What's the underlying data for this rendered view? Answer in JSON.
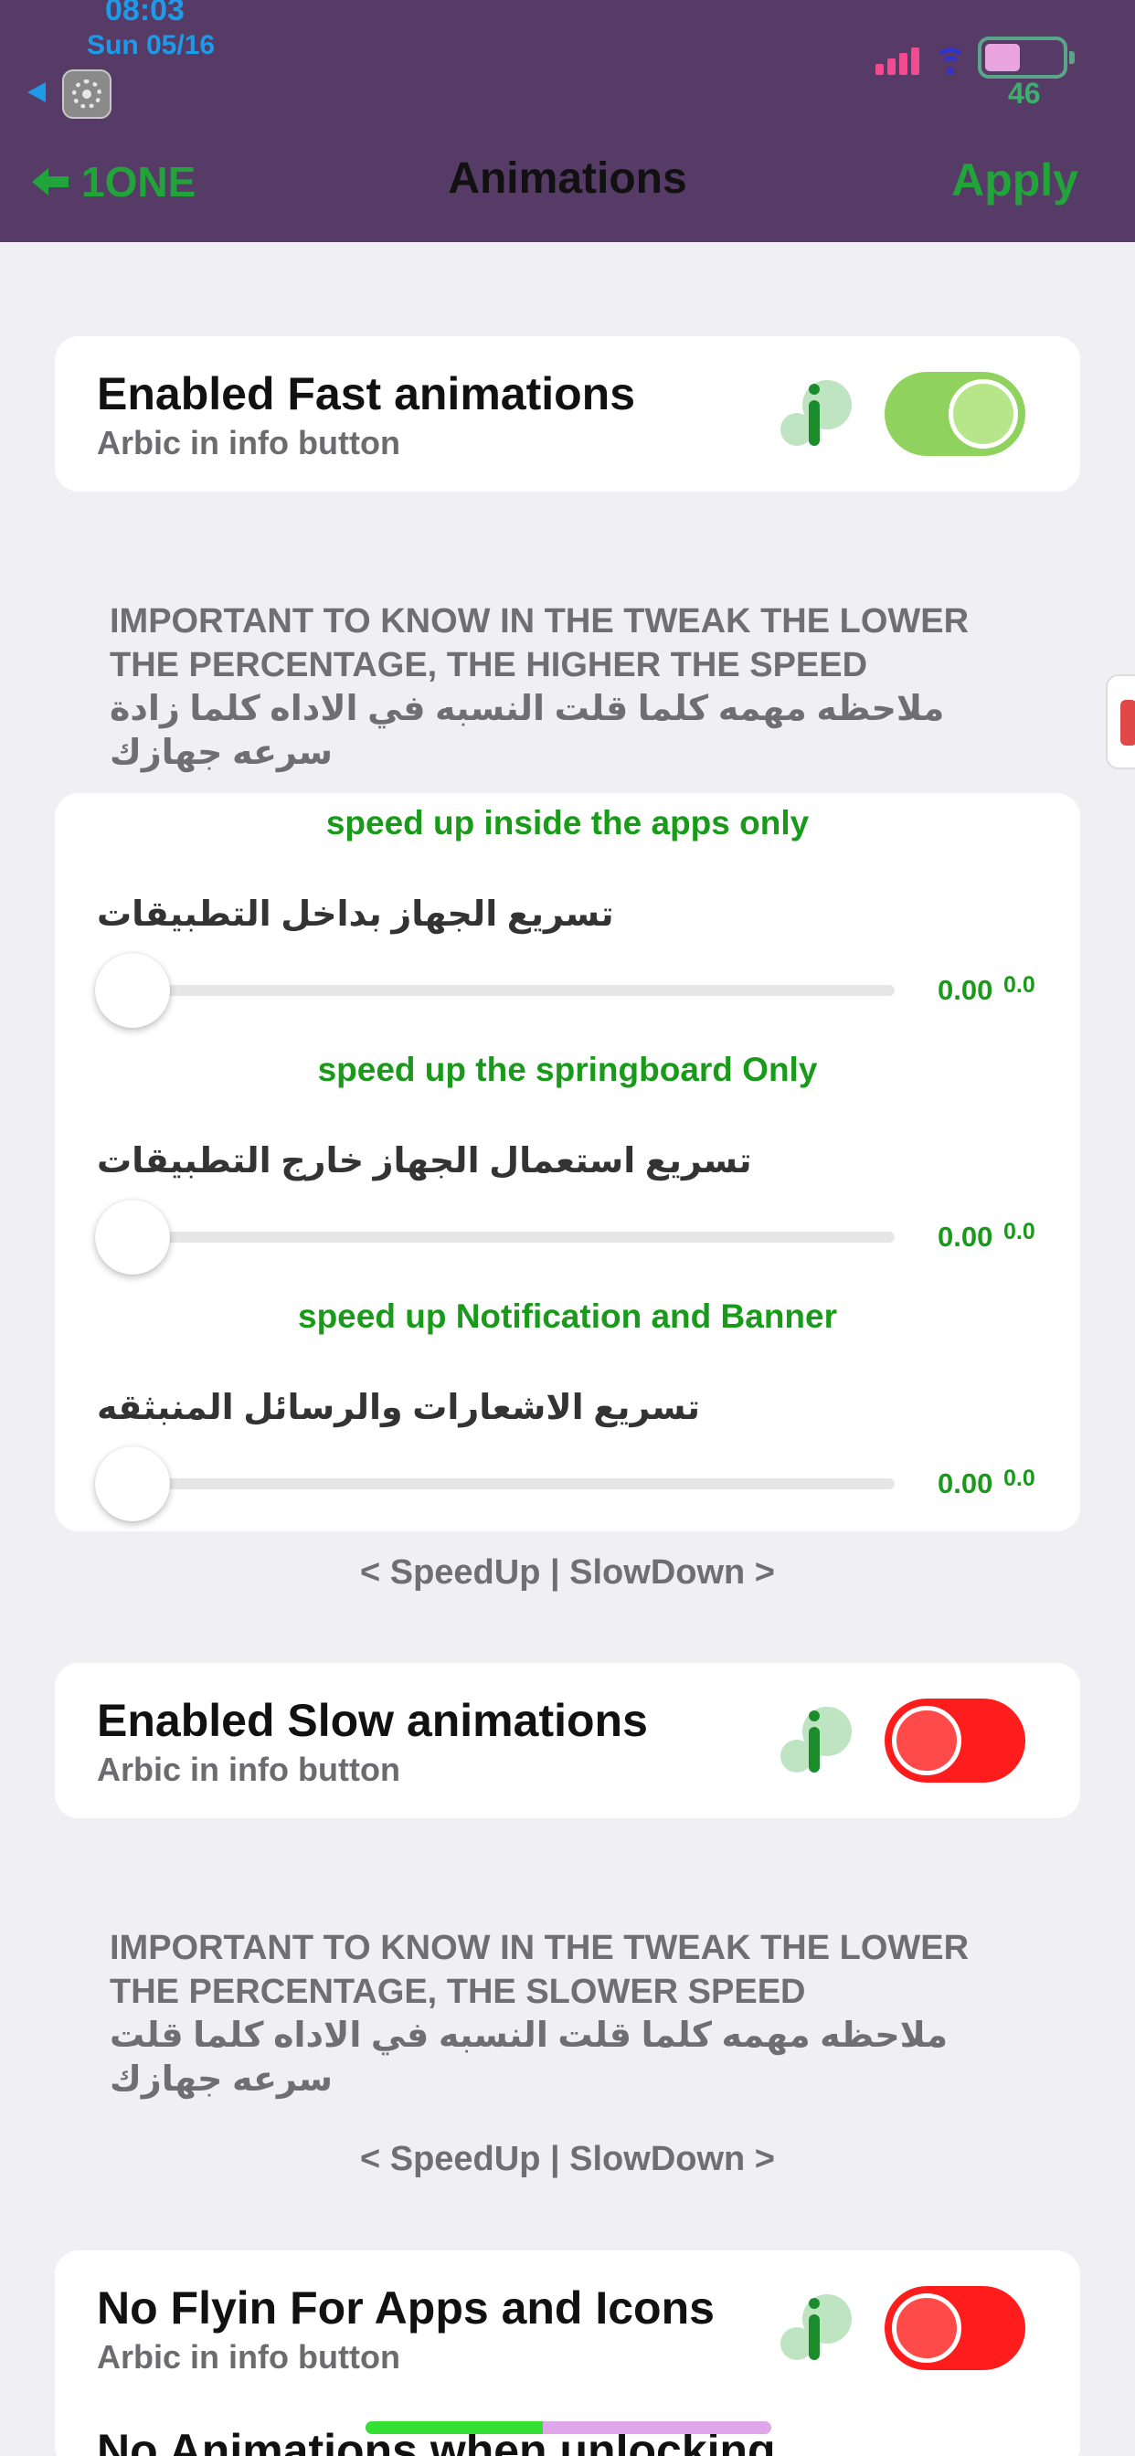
{
  "status_bar": {
    "time": "08:03",
    "date": "Sun 05/16",
    "battery_percent": "46",
    "battery_level": 0.46,
    "colors": {
      "background": "#553b65",
      "time": "#1e9be8",
      "signal": "#f24b8f",
      "wifi": "#3432c9",
      "battery": "#5aa58a"
    },
    "icons": [
      "back-triangle-icon",
      "settings-app-icon",
      "signal-bars-icon",
      "wifi-icon",
      "battery-icon"
    ]
  },
  "nav": {
    "back_label": "1ONE",
    "title": "Animations",
    "apply_label": "Apply",
    "accent_color": "#21a53a"
  },
  "fast": {
    "title": "Enabled Fast animations",
    "subtitle": "Arbic in info button",
    "toggle_on": true,
    "icon": "info-icon"
  },
  "fast_note": {
    "line1": "IMPORTANT TO KNOW IN THE TWEAK THE LOWER",
    "line2": "THE PERCENTAGE, THE HIGHER THE SPEED",
    "line3": "ملاحظه مهمه كلما قلت النسبه في الاداه كلما زادة",
    "line4": "سرعه جهازك"
  },
  "sliders": [
    {
      "heading": "speed up inside the apps only",
      "label": "تسريع الجهاز بداخل التطبيقات",
      "value": "0.00",
      "value_small": "0.0",
      "level": 0
    },
    {
      "heading": "speed up the springboard Only",
      "label": "تسريع استعمال الجهاز خارج التطبيقات",
      "value": "0.00",
      "value_small": "0.0",
      "level": 0
    },
    {
      "heading": "speed up Notification and Banner",
      "label": "تسريع الاشعارات والرسائل المنبثقه",
      "value": "0.00",
      "value_small": "0.0",
      "level": 0
    }
  ],
  "speed_toggle_note_1": "< SpeedUp | SlowDown >",
  "slow": {
    "title": "Enabled Slow animations",
    "subtitle": "Arbic in info button",
    "toggle_on": false,
    "icon": "info-icon"
  },
  "slow_note": {
    "line1": "IMPORTANT TO KNOW IN THE TWEAK THE LOWER",
    "line2": "THE PERCENTAGE, THE SLOWER SPEED",
    "line3": "ملاحظه مهمه كلما قلت النسبه في الاداه كلما قلت",
    "line4": "سرعه جهازك"
  },
  "speed_toggle_note_2": "< SpeedUp | SlowDown >",
  "noflyin": {
    "title": "No Flyin For Apps and Icons",
    "subtitle": "Arbic in info button",
    "toggle_on": false,
    "icon": "info-icon"
  },
  "unlock": {
    "title": "No Animations when unlocking"
  },
  "toggle_colors": {
    "on": "#8fd35e",
    "off": "#ff1c1c"
  }
}
